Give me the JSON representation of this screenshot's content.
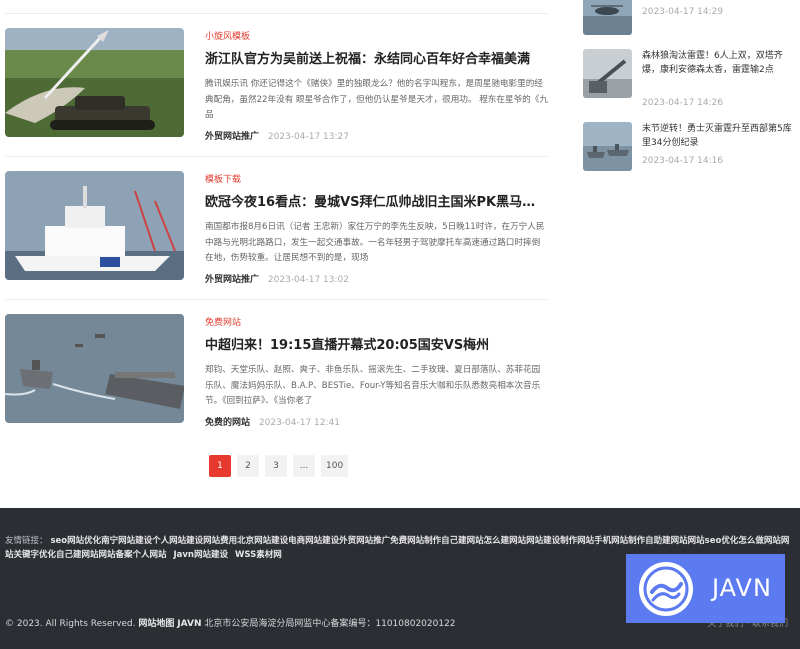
{
  "articles": [
    {
      "category": "小旋风模板",
      "title": "浙江队官方为吴前送上祝福：永结同心百年好合幸福美满",
      "excerpt": "腾讯娱乐讯 你还记得这个《赌侠》里的独眼龙么？他的名字叫程东，是周星驰电影里的经典配角，虽然22年没有 眼星爷合作了，但他仍认星爷是天才，很用功。 程东在星爷的《九品",
      "author": "外贸网站推广",
      "date": "2023-04-17 13:27",
      "image": "tank-missile-image"
    },
    {
      "category": "模板下载",
      "title": "欧冠今夜16看点：曼城VS拜仁瓜帅战旧主国米PK黑马锋霸...",
      "excerpt": "南国都市报8月6日讯（记者 王忠新）家住万宁的李先生反映，5日晚11时许，在万宁人民中路与光明北路路口，发生一起交通事故。一名年轻男子驾驶摩托车高速通过路口时摔倒在地，伤势较重。让居民想不到的是，现场",
      "author": "外贸网站推广",
      "date": "2023-04-17 13:02",
      "image": "coast-guard-ship-image"
    },
    {
      "category": "免费网站",
      "title": "中超归来！19:15直播开幕式20:05国安VS梅州",
      "excerpt": "郑钧、天堂乐队、赵照、爽子、非鱼乐队、摇滚先生、二手玫瑰、夏日部落队、苏菲花园乐队、魔法妈妈乐队、B.A.P、BESTie、Four-Y等知名音乐大咖和乐队悉数亮相本次音乐节。《回到拉萨》、《当你老了",
      "author": "免费的网站",
      "date": "2023-04-17 12:41",
      "image": "aircraft-carrier-fleet-image"
    }
  ],
  "pagination": {
    "pages": [
      "1",
      "2",
      "3",
      "...",
      "100"
    ]
  },
  "sidebar": [
    {
      "title": "",
      "date": "2023-04-17 14:29",
      "image": "helicopter-image"
    },
    {
      "title": "森林狼淘汰雷霆！6人上双，双塔齐爆，康利安德森太香，雷霆输2点",
      "date": "2023-04-17 14:26",
      "image": "cannon-image"
    },
    {
      "title": "末节逆转！勇士灭雷霆升至西部第5库里34分创纪录",
      "date": "2023-04-17 14:16",
      "image": "warships-image"
    }
  ],
  "footer": {
    "links_label": "友情链接：",
    "links": [
      "seo网站优化南宁网站建设个人网站建设网站费用北京网站建设电商网站建设外贸网站推广免费网站制作自己建网站怎么建网站网站建设制作网站手机网站制作自助建网站网站seo优化怎么做网站网站关键字优化自己建网站网站备案个人网站",
      "Javn网站建设",
      "WSS素材网"
    ],
    "copyright": "© 2023. All Rights Reserved.",
    "sitemap": "网站地图",
    "brand": "JAVN",
    "icp": "北京市公安局海淀分局网监中心备案编号：11010802020122",
    "right_text": "关于我们 · 联系我们"
  },
  "badge": {
    "name": "JAVN"
  },
  "colors": {
    "accent": "#e8392f",
    "footer_bg": "#2b2e33",
    "badge_bg": "#5d7bf0"
  }
}
